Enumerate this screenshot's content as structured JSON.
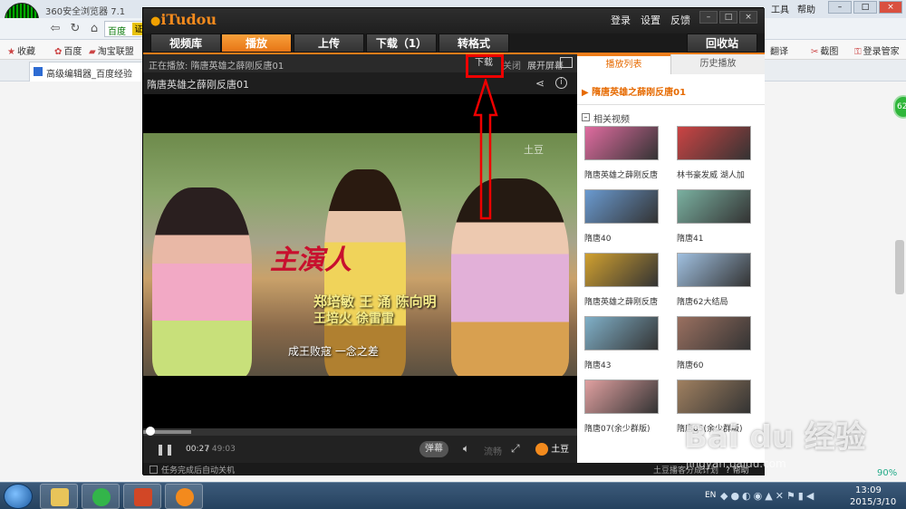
{
  "browser": {
    "name": "360安全浏览器 7.1",
    "url_site": "百度",
    "url_tag": "证",
    "menu": [
      "工具",
      "帮助"
    ],
    "bookmarks": [
      "收藏",
      "百度",
      "淘宝联盟"
    ],
    "bookmarks_right": [
      "翻译",
      "截图",
      "登录管家"
    ],
    "tab_title": "高级编辑器_百度经验",
    "side_badge": "62"
  },
  "itudou": {
    "logo": "iTudou",
    "title_links": [
      "登录",
      "设置",
      "反馈"
    ],
    "tabs": [
      "视频库",
      "播放",
      "上传",
      "下载（1）",
      "转格式"
    ],
    "active_tab": "播放",
    "recycle": "回收站",
    "now_playing_label": "正在播放:  隋唐英雄之薛刚反唐01",
    "download_btn": "下载",
    "close_btn": "关闭",
    "expand_btn": "展开屏幕",
    "video_title": "隋唐英雄之薛刚反唐01",
    "credits": {
      "script": "主演人",
      "line1": "郑培敏 王  涌 陈向明",
      "line2": "王培火 徐雷雷",
      "line3": "成王败寇    一念之差"
    },
    "watermark": "土豆",
    "progress": 0.11,
    "time_current": "00:27",
    "time_total": "49:03",
    "danmu": "弹幕",
    "quality": "流畅",
    "tudou_logo": "土豆",
    "auto_off": "任务完成后自动关机",
    "status_right": "土豆播客分成计划",
    "help": "帮助",
    "playlist": {
      "tabs": [
        "播放列表",
        "历史播放"
      ],
      "now": "隋唐英雄之薛刚反唐01",
      "related_label": "相关视频",
      "items": [
        {
          "label": "隋唐英雄之薛刚反唐",
          "color": "#e06ca0"
        },
        {
          "label": "林书豪发威 湖人加",
          "color": "#c44"
        },
        {
          "label": "隋唐40",
          "color": "#6a9ad0"
        },
        {
          "label": "隋唐41",
          "color": "#7ab0a0"
        },
        {
          "label": "隋唐英雄之薛刚反唐",
          "color": "#d0a030"
        },
        {
          "label": "隋唐62大结局",
          "color": "#a0c0e0"
        },
        {
          "label": "隋唐43",
          "color": "#80b0c8"
        },
        {
          "label": "隋唐60",
          "color": "#9a7060"
        },
        {
          "label": "隋唐07(余少群版)",
          "color": "#e0a0a0"
        },
        {
          "label": "隋唐05(余少群版)",
          "color": "#a08060"
        }
      ]
    }
  },
  "taskbar": {
    "lang": "EN",
    "time": "13:09",
    "date": "2015/3/10",
    "zoom": "90%"
  },
  "watermark": {
    "text": "Bai du 经验",
    "sub": "jingyan.baidu.com"
  }
}
